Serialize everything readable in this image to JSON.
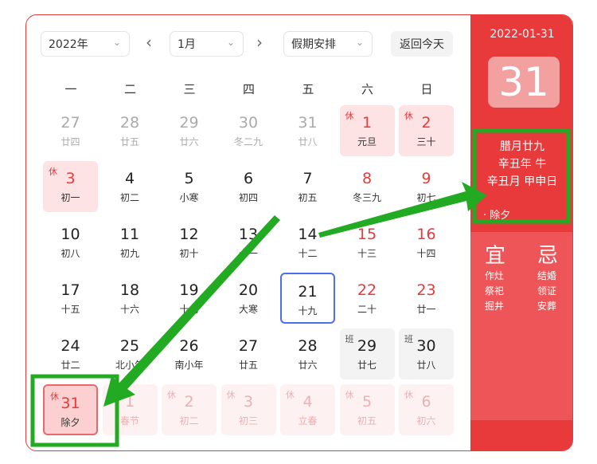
{
  "controls": {
    "year": "2022年",
    "month": "1月",
    "holiday_select": "假期安排",
    "today_button": "返回今天",
    "prev_icon": "chevron-left-icon",
    "next_icon": "chevron-right-icon"
  },
  "weekdays": [
    "一",
    "二",
    "三",
    "四",
    "五",
    "六",
    "日"
  ],
  "days": [
    {
      "day": "27",
      "lunar": "廿四",
      "type": "other"
    },
    {
      "day": "28",
      "lunar": "廿五",
      "type": "other"
    },
    {
      "day": "29",
      "lunar": "廿六",
      "type": "other"
    },
    {
      "day": "30",
      "lunar": "冬二九",
      "type": "other"
    },
    {
      "day": "31",
      "lunar": "廿八",
      "type": "other"
    },
    {
      "day": "1",
      "lunar": "元旦",
      "type": "holiday",
      "tag": "休"
    },
    {
      "day": "2",
      "lunar": "三十",
      "type": "holiday",
      "tag": "休"
    },
    {
      "day": "3",
      "lunar": "初一",
      "type": "holiday",
      "tag": "休"
    },
    {
      "day": "4",
      "lunar": "初二",
      "type": "normal"
    },
    {
      "day": "5",
      "lunar": "小寒",
      "type": "normal"
    },
    {
      "day": "6",
      "lunar": "初四",
      "type": "normal"
    },
    {
      "day": "7",
      "lunar": "初五",
      "type": "normal"
    },
    {
      "day": "8",
      "lunar": "冬三九",
      "type": "weekend"
    },
    {
      "day": "9",
      "lunar": "初七",
      "type": "weekend"
    },
    {
      "day": "10",
      "lunar": "初八",
      "type": "normal"
    },
    {
      "day": "11",
      "lunar": "初九",
      "type": "normal"
    },
    {
      "day": "12",
      "lunar": "初十",
      "type": "normal"
    },
    {
      "day": "13",
      "lunar": "十一",
      "type": "normal"
    },
    {
      "day": "14",
      "lunar": "十二",
      "type": "normal"
    },
    {
      "day": "15",
      "lunar": "十三",
      "type": "weekend"
    },
    {
      "day": "16",
      "lunar": "十四",
      "type": "weekend"
    },
    {
      "day": "17",
      "lunar": "十五",
      "type": "normal"
    },
    {
      "day": "18",
      "lunar": "十六",
      "type": "normal"
    },
    {
      "day": "19",
      "lunar": "十七",
      "type": "normal"
    },
    {
      "day": "20",
      "lunar": "大寒",
      "type": "normal"
    },
    {
      "day": "21",
      "lunar": "十九",
      "type": "today"
    },
    {
      "day": "22",
      "lunar": "二十",
      "type": "weekend"
    },
    {
      "day": "23",
      "lunar": "廿一",
      "type": "weekend"
    },
    {
      "day": "24",
      "lunar": "廿二",
      "type": "normal"
    },
    {
      "day": "25",
      "lunar": "北小年",
      "type": "normal"
    },
    {
      "day": "26",
      "lunar": "南小年",
      "type": "normal"
    },
    {
      "day": "27",
      "lunar": "廿五",
      "type": "normal"
    },
    {
      "day": "28",
      "lunar": "廿六",
      "type": "normal"
    },
    {
      "day": "29",
      "lunar": "廿七",
      "type": "workday",
      "tag": "班"
    },
    {
      "day": "30",
      "lunar": "廿八",
      "type": "workday",
      "tag": "班"
    },
    {
      "day": "31",
      "lunar": "除夕",
      "type": "selected",
      "tag": "休"
    },
    {
      "day": "1",
      "lunar": "春节",
      "type": "nextholiday",
      "tag": "休"
    },
    {
      "day": "2",
      "lunar": "初二",
      "type": "nextholiday",
      "tag": "休"
    },
    {
      "day": "3",
      "lunar": "初三",
      "type": "nextholiday",
      "tag": "休"
    },
    {
      "day": "4",
      "lunar": "立春",
      "type": "nextholiday",
      "tag": "休"
    },
    {
      "day": "5",
      "lunar": "初五",
      "type": "nextholiday",
      "tag": "休"
    },
    {
      "day": "6",
      "lunar": "初六",
      "type": "nextholiday",
      "tag": "休"
    }
  ],
  "panel": {
    "date": "2022-01-31",
    "day": "31",
    "lunar_date": "腊月廿九",
    "year_ganzhi": "辛丑年 牛",
    "month_day_ganzhi": "辛丑月 甲申日",
    "festival": "· 除夕",
    "yi_title": "宜",
    "yi_items": [
      "作灶",
      "祭祀",
      "掘井"
    ],
    "ji_title": "忌",
    "ji_items": [
      "结婚",
      "领证",
      "安葬"
    ]
  },
  "colors": {
    "accent": "#e8393b",
    "today_border": "#4e6ef2",
    "annotation": "#22aa22"
  }
}
